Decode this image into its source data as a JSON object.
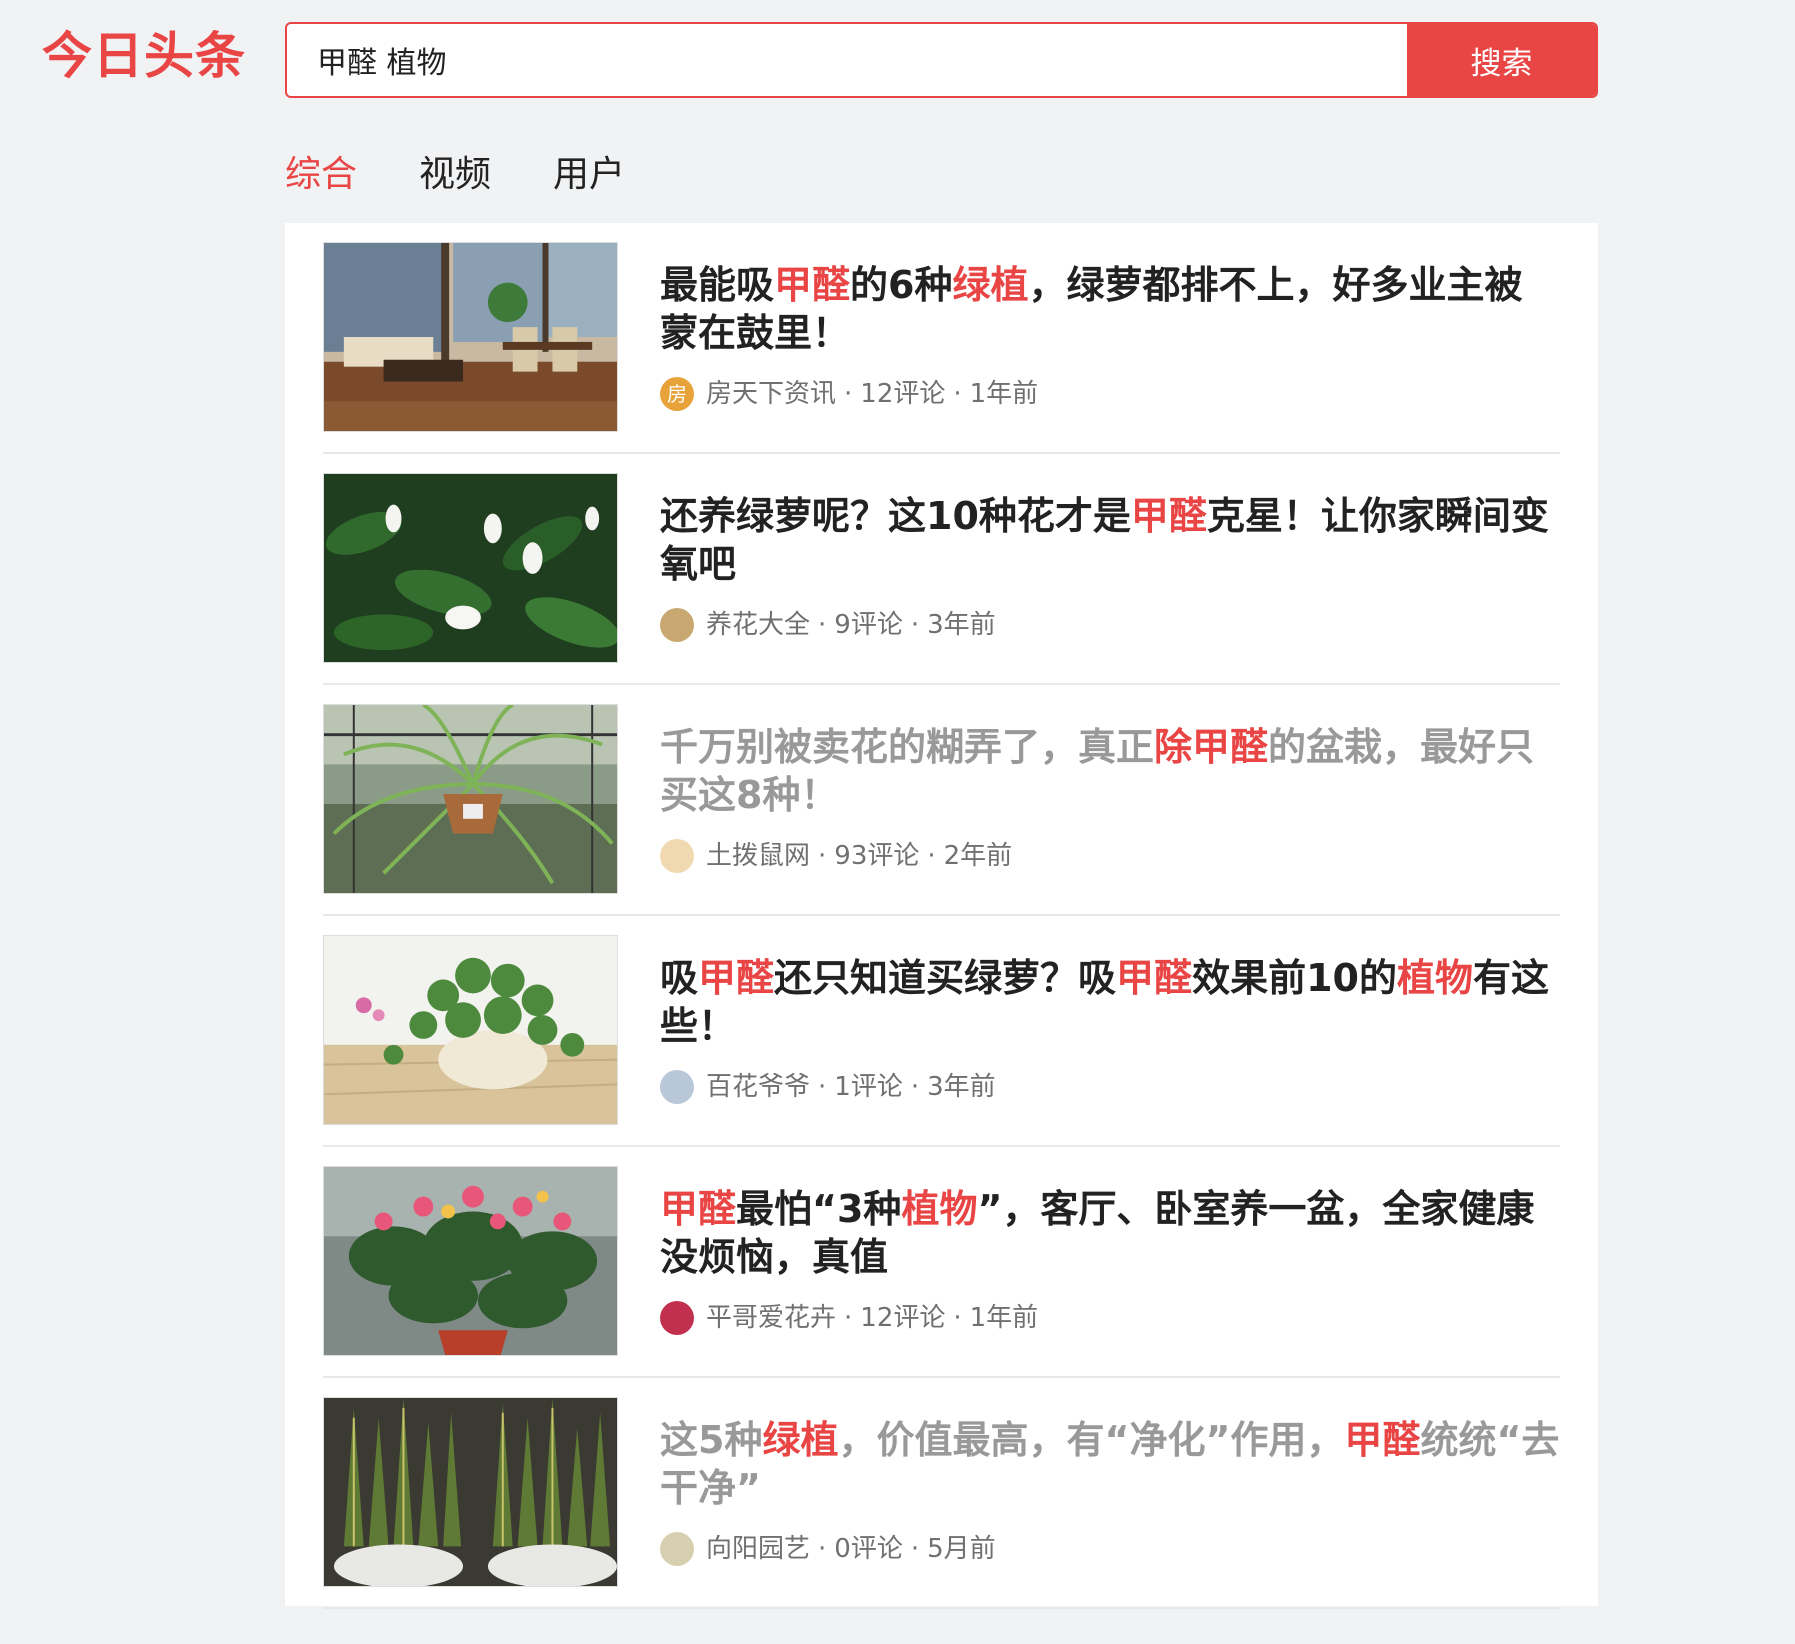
{
  "header": {
    "logo": "今日头条",
    "search_value": "甲醛 植物",
    "search_button": "搜索"
  },
  "tabs": [
    {
      "label": "综合",
      "active": true
    },
    {
      "label": "视频",
      "active": false
    },
    {
      "label": "用户",
      "active": false
    }
  ],
  "colors": {
    "accent": "#e94545",
    "visited_title": "#999999"
  },
  "results": [
    {
      "title_parts": [
        {
          "t": "最能吸"
        },
        {
          "t": "甲醛",
          "hl": true
        },
        {
          "t": "的6种"
        },
        {
          "t": "绿植",
          "hl": true
        },
        {
          "t": "，绿萝都排不上，好多业主被蒙在鼓里！"
        }
      ],
      "visited": false,
      "author": "房天下资讯",
      "comments": "12评论",
      "time": "1年前",
      "avatar_icon": "fang-avatar-icon",
      "avatar_text": "房",
      "thumb_icon": "living-room-thumbnail"
    },
    {
      "title_parts": [
        {
          "t": "还养绿萝呢？这10种花才是"
        },
        {
          "t": "甲醛",
          "hl": true
        },
        {
          "t": "克星！让你家瞬间变氧吧"
        }
      ],
      "visited": false,
      "author": "养花大全",
      "comments": "9评论",
      "time": "3年前",
      "avatar_icon": "flower-avatar-icon",
      "avatar_text": "",
      "thumb_icon": "peace-lily-thumbnail"
    },
    {
      "title_parts": [
        {
          "t": "千万别被卖花的糊弄了，真正"
        },
        {
          "t": "除甲醛",
          "hl": true
        },
        {
          "t": "的盆栽，最好只买这8种！"
        }
      ],
      "visited": true,
      "author": "土拨鼠网",
      "comments": "93评论",
      "time": "2年前",
      "avatar_icon": "groundhog-avatar-icon",
      "avatar_text": "",
      "thumb_icon": "spider-plant-thumbnail"
    },
    {
      "title_parts": [
        {
          "t": "吸"
        },
        {
          "t": "甲醛",
          "hl": true
        },
        {
          "t": "还只知道买绿萝？吸"
        },
        {
          "t": "甲醛",
          "hl": true
        },
        {
          "t": "效果前10的"
        },
        {
          "t": "植物",
          "hl": true
        },
        {
          "t": "有这些！"
        }
      ],
      "visited": false,
      "author": "百花爷爷",
      "comments": "1评论",
      "time": "3年前",
      "avatar_icon": "grandpa-avatar-icon",
      "avatar_text": "",
      "thumb_icon": "ivy-pot-thumbnail"
    },
    {
      "title_parts": [
        {
          "t": "甲醛",
          "hl": true
        },
        {
          "t": "最怕“3种"
        },
        {
          "t": "植物",
          "hl": true
        },
        {
          "t": "”，客厅、卧室养一盆，全家健康没烦恼，真值"
        }
      ],
      "visited": false,
      "author": "平哥爱花卉",
      "comments": "12评论",
      "time": "1年前",
      "avatar_icon": "red-flower-avatar-icon",
      "avatar_text": "",
      "thumb_icon": "begonia-thumbnail"
    },
    {
      "title_parts": [
        {
          "t": "这5种"
        },
        {
          "t": "绿植",
          "hl": true
        },
        {
          "t": "，价值最高，有“净化”作用，"
        },
        {
          "t": "甲醛",
          "hl": true
        },
        {
          "t": "统统“去干净”"
        }
      ],
      "visited": true,
      "author": "向阳园艺",
      "comments": "0评论",
      "time": "5月前",
      "avatar_icon": "garden-avatar-icon",
      "avatar_text": "",
      "thumb_icon": "snake-plant-thumbnail"
    }
  ]
}
